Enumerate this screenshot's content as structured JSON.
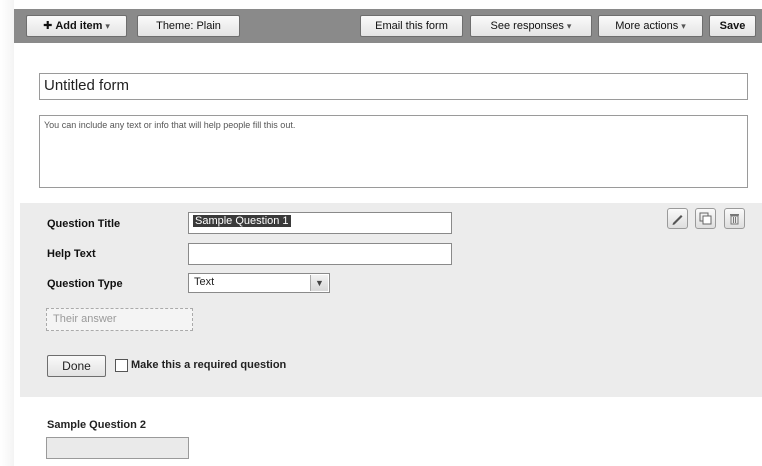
{
  "toolbar": {
    "add_item": "Add item",
    "theme": "Theme: Plain",
    "email": "Email this form",
    "see_responses": "See responses",
    "more_actions": "More actions",
    "save": "Save"
  },
  "form": {
    "title": "Untitled form",
    "description": "You can include any text or info that will help people fill this out."
  },
  "question_editor": {
    "title_label": "Question Title",
    "title_value": "Sample Question 1",
    "help_label": "Help Text",
    "help_value": "",
    "type_label": "Question Type",
    "type_value": "Text",
    "answer_placeholder": "Their answer",
    "done": "Done",
    "required_label": "Make this a required question",
    "required_checked": false
  },
  "question2": {
    "title": "Sample Question 2"
  },
  "icons": [
    "plus-icon",
    "chevron-down-icon",
    "pencil-icon",
    "duplicate-icon",
    "trash-icon"
  ]
}
